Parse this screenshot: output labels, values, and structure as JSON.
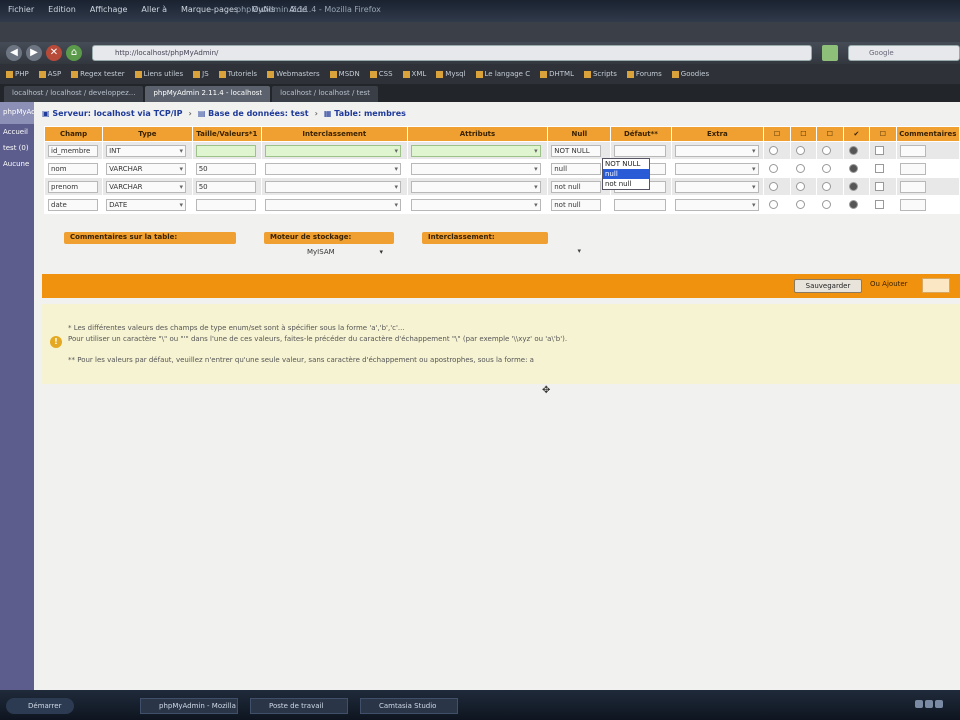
{
  "window": {
    "menu": [
      "Fichier",
      "Edition",
      "Affichage",
      "Aller à",
      "Marque-pages",
      "Outils",
      "Aide"
    ],
    "title": "phpMyAdmin 2.11.4 - Mozilla Firefox"
  },
  "navbar": {
    "url": "http://localhost/phpMyAdmin/",
    "search_placeholder": "Google"
  },
  "bookmarks": [
    "PHP",
    "ASP",
    "Regex tester",
    "Liens utiles",
    "JS",
    "Tutoriels",
    "Webmasters",
    "MSDN",
    "CSS",
    "XML",
    "Mysql",
    "Le langage C",
    "DHTML",
    "Scripts",
    "Forums",
    "Goodies"
  ],
  "tabs": [
    {
      "label": "localhost / localhost / developpez...",
      "active": false
    },
    {
      "label": "phpMyAdmin 2.11.4 - localhost",
      "active": true
    },
    {
      "label": "localhost / localhost / test",
      "active": false
    }
  ],
  "leftframe": {
    "top": "phpMyAdmin",
    "links": [
      "Accueil",
      "test (0)",
      "Aucune"
    ]
  },
  "breadcrumb": [
    {
      "icon": "server-icon",
      "label": "Serveur: localhost via TCP/IP"
    },
    {
      "icon": "database-icon",
      "label": "Base de données: test"
    },
    {
      "icon": "table-icon",
      "label": "Table: membres"
    }
  ],
  "table": {
    "headers": [
      "Champ",
      "Type",
      "Taille/Valeurs*1",
      "Interclassement",
      "Attributs",
      "Null",
      "Défaut**",
      "Extra",
      "☐",
      "☐",
      "☐",
      "✔",
      "☐",
      "Commentaires"
    ],
    "rows": [
      {
        "name": "id_membre",
        "type": "INT",
        "length": "",
        "collation": "",
        "attributes": "",
        "null": "NOT NULL",
        "default": "",
        "extra": ""
      },
      {
        "name": "nom",
        "type": "VARCHAR",
        "length": "50",
        "collation": "",
        "attributes": "",
        "null": "null",
        "default": "",
        "extra": ""
      },
      {
        "name": "prenom",
        "type": "VARCHAR",
        "length": "50",
        "collation": "",
        "attributes": "",
        "null": "not null",
        "default": "",
        "extra": ""
      },
      {
        "name": "date",
        "type": "DATE",
        "length": "",
        "collation": "",
        "attributes": "",
        "null": "not null",
        "default": "",
        "extra": ""
      }
    ],
    "null_dropdown": [
      "NOT NULL",
      "null",
      "not null"
    ]
  },
  "options": {
    "comments_label": "Commentaires sur la table:",
    "engine_label": "Moteur de stockage:",
    "engine_value": "MyISAM",
    "collation_label": "Interclassement:"
  },
  "savebar": {
    "save_label": "Sauvegarder",
    "add_label": "Ou Ajouter",
    "add_count": ""
  },
  "notes": [
    "* Les différentes valeurs des champs de type enum/set sont à spécifier sous la forme 'a','b','c'...",
    "Pour utiliser un caractère \"\\\" ou \"'\" dans l'une de ces valeurs, faites-le précéder du caractère d'échappement \"\\\" (par exemple '\\\\xyz' ou 'a\\'b').",
    "** Pour les valeurs par défaut, veuillez n'entrer qu'une seule valeur, sans caractère d'échappement ou apostrophes, sous la forme: a"
  ],
  "taskbar": {
    "start": "Démarrer",
    "tasks": [
      "phpMyAdmin - Mozilla",
      "Poste de travail",
      "Camtasia Studio"
    ]
  }
}
